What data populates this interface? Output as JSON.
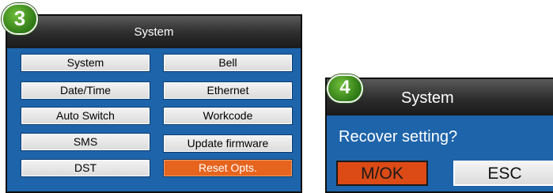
{
  "screen_left": {
    "step": "3",
    "title": "System",
    "menu": [
      {
        "label": "System"
      },
      {
        "label": "Bell"
      },
      {
        "label": "Date/Time"
      },
      {
        "label": "Ethernet"
      },
      {
        "label": "Auto Switch"
      },
      {
        "label": "Workcode"
      },
      {
        "label": "SMS"
      },
      {
        "label": "Update firmware"
      },
      {
        "label": "DST"
      },
      {
        "label": "Reset Opts.",
        "selected": true
      }
    ]
  },
  "screen_right": {
    "step": "4",
    "title": "System",
    "prompt": "Recover setting?",
    "ok_label": "M/OK",
    "esc_label": "ESC"
  },
  "colors": {
    "screen_blue": "#1e64aa",
    "selected_orange": "#e6641e",
    "badge_green": "#3d8f1f"
  }
}
